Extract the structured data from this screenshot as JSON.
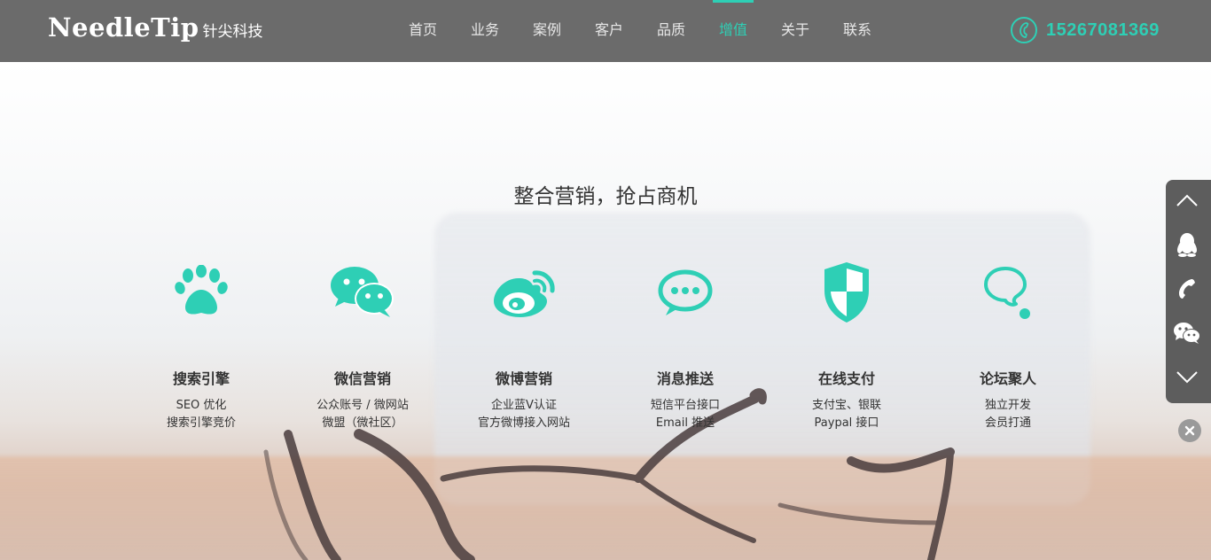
{
  "brand": {
    "logo_en": "NeedleTip",
    "logo_cn": "针尖科技"
  },
  "nav": [
    {
      "label": "首页",
      "active": false
    },
    {
      "label": "业务",
      "active": false
    },
    {
      "label": "案例",
      "active": false
    },
    {
      "label": "客户",
      "active": false
    },
    {
      "label": "品质",
      "active": false
    },
    {
      "label": "增值",
      "active": true
    },
    {
      "label": "关于",
      "active": false
    },
    {
      "label": "联系",
      "active": false
    }
  ],
  "header": {
    "phone": "15267081369",
    "phone_icon": "phone-icon"
  },
  "section": {
    "title": "整合营销，抢占商机"
  },
  "features": [
    {
      "icon": "paw-icon",
      "title": "搜索引擎",
      "line1": "SEO 优化",
      "line2": "搜索引擎竞价"
    },
    {
      "icon": "wechat-icon",
      "title": "微信营销",
      "line1": "公众账号 / 微网站",
      "line2": "微盟（微社区）"
    },
    {
      "icon": "weibo-icon",
      "title": "微博营销",
      "line1": "企业蓝V认证",
      "line2": "官方微博接入网站"
    },
    {
      "icon": "message-icon",
      "title": "消息推送",
      "line1": "短信平台接口",
      "line2": "Email 推送"
    },
    {
      "icon": "shield-icon",
      "title": "在线支付",
      "line1": "支付宝、银联",
      "line2": "Paypal 接口"
    },
    {
      "icon": "forum-bubble-icon",
      "title": "论坛聚人",
      "line1": "独立开发",
      "line2": "会员打通"
    }
  ],
  "sidebar": [
    "chevron-up-icon",
    "qq-icon",
    "phone-icon",
    "wechat-icon",
    "chevron-down-icon"
  ],
  "colors": {
    "accent": "#2ecfb5",
    "header_bg": "#6b6b6b",
    "sidebar_bg": "#5d5d5d"
  }
}
